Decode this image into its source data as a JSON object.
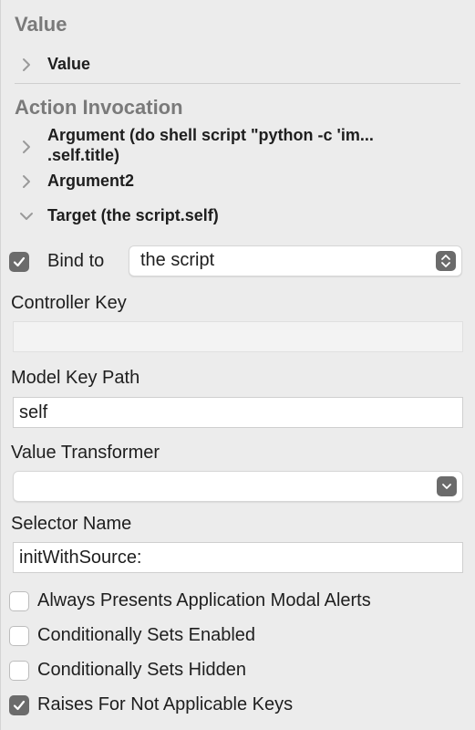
{
  "sections": {
    "value": {
      "header": "Value",
      "items": [
        {
          "label": "Value"
        }
      ]
    },
    "action_invocation": {
      "header": "Action Invocation",
      "items": [
        {
          "label_line1": "Argument (do shell script \"python -c 'im...",
          "label_line2": ".self.title)"
        },
        {
          "label": "Argument2"
        },
        {
          "label": "Target (the script.self)"
        }
      ]
    }
  },
  "bind": {
    "checked": true,
    "label": "Bind to",
    "popup_value": "the script"
  },
  "controller_key": {
    "label": "Controller Key",
    "value": ""
  },
  "model_key_path": {
    "label": "Model Key Path",
    "value": "self"
  },
  "value_transformer": {
    "label": "Value Transformer",
    "value": ""
  },
  "selector_name": {
    "label": "Selector Name",
    "value": "initWithSource:"
  },
  "options": [
    {
      "label": "Always Presents Application Modal Alerts",
      "checked": false
    },
    {
      "label": "Conditionally Sets Enabled",
      "checked": false
    },
    {
      "label": "Conditionally Sets Hidden",
      "checked": false
    },
    {
      "label": "Raises For Not Applicable Keys",
      "checked": true
    }
  ],
  "colors": {
    "panel_bg": "#ececec",
    "section_header": "#7a7a7a",
    "checkbox_on": "#6b6b6b"
  }
}
